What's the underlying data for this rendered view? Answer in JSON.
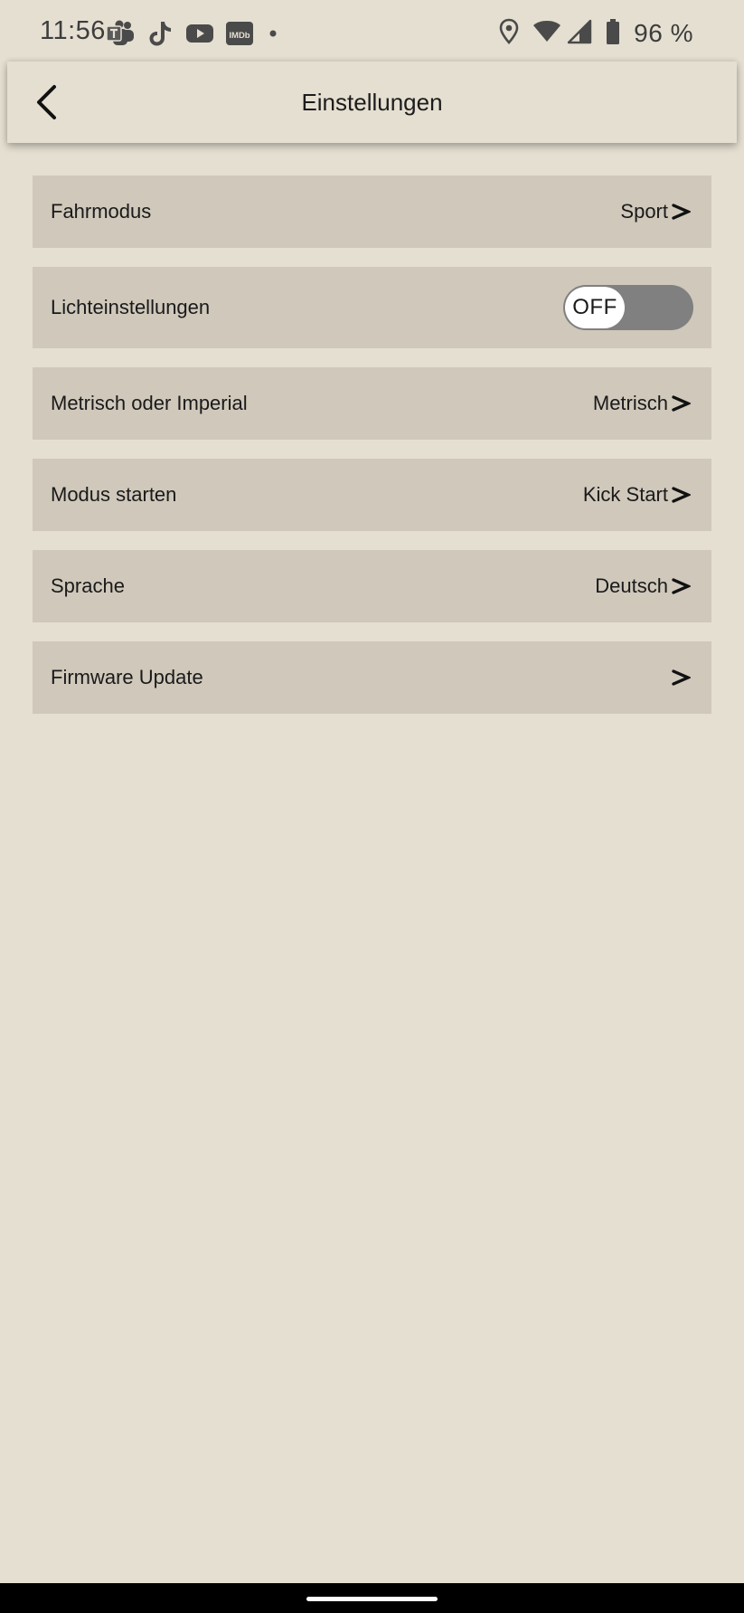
{
  "status_bar": {
    "time": "11:56",
    "app_icons": [
      "teams-icon",
      "tiktok-icon",
      "youtube-icon",
      "imdb-icon",
      "dot-icon"
    ],
    "imdb_label": "IMDb",
    "battery": "96 %",
    "system_icons": [
      "location-icon",
      "wifi-icon",
      "cellular-signal-icon",
      "battery-icon"
    ]
  },
  "header": {
    "title": "Einstellungen",
    "back_icon": "chevron-left-icon"
  },
  "settings": [
    {
      "label": "Fahrmodus",
      "value": "Sport"
    },
    {
      "label": "Lichteinstellungen",
      "toggle": "OFF",
      "toggle_on": false
    },
    {
      "label": "Metrisch oder Imperial",
      "value": "Metrisch"
    },
    {
      "label": "Modus starten",
      "value": "Kick Start"
    },
    {
      "label": "Sprache",
      "value": "Deutsch"
    },
    {
      "label": "Firmware Update",
      "value": ""
    }
  ],
  "colors": {
    "background": "#e5dfd1",
    "row_background": "#cfc8bb",
    "toggle_track_off": "#808080",
    "toggle_knob": "#ffffff",
    "nav_bar": "#000000"
  }
}
